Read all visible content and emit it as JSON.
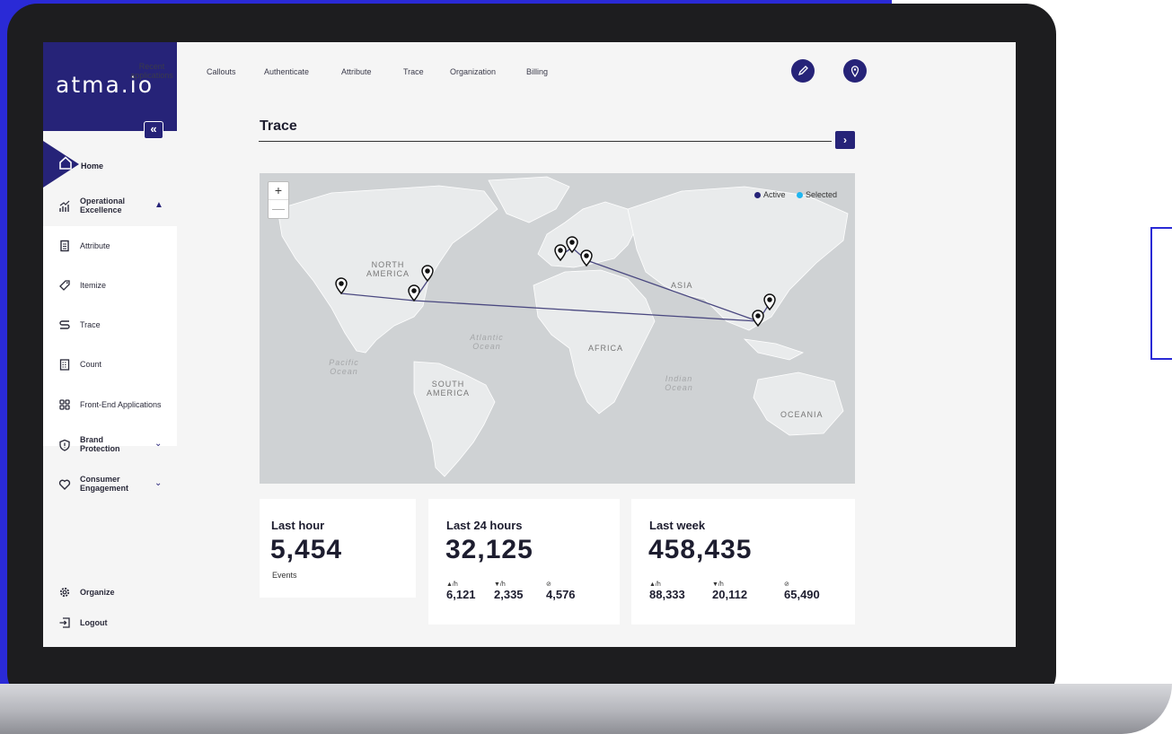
{
  "app": {
    "brand": "atma.io",
    "collapse_symbol": "«"
  },
  "sidebar": {
    "home": "Home",
    "operational": "Operational Excellence",
    "items": [
      {
        "label": "Attribute",
        "icon": "attribute-icon"
      },
      {
        "label": "Itemize",
        "icon": "tag-icon"
      },
      {
        "label": "Trace",
        "icon": "trace-icon"
      },
      {
        "label": "Count",
        "icon": "count-icon"
      },
      {
        "label": "Front-End Applications",
        "icon": "apps-icon"
      }
    ],
    "brand_protection": "Brand Protection",
    "consumer_engagement": "Consumer Engagement",
    "organize": "Organize",
    "logout": "Logout"
  },
  "topnav": {
    "recent": "Recent applications",
    "items": [
      "Callouts",
      "Authenticate",
      "Attribute",
      "Trace",
      "Organization",
      "Billing"
    ]
  },
  "page": {
    "title": "Trace",
    "next_symbol": "›"
  },
  "map": {
    "zoom_in": "+",
    "zoom_out": "—",
    "legend": [
      {
        "label": "Active",
        "color": "#262378"
      },
      {
        "label": "Selected",
        "color": "#1fb6f0"
      }
    ],
    "labels": {
      "north_america": "NORTH AMERICA",
      "south_america": "SOUTH AMERICA",
      "africa": "AFRICA",
      "asia": "ASIA",
      "oceania": "OCEANIA",
      "atlantic": "Atlantic Ocean",
      "pacific": "Pacific Ocean",
      "indian": "Indian Ocean"
    }
  },
  "stats": {
    "hour": {
      "period": "Last hour",
      "value": "5,454",
      "unit": "Events"
    },
    "day": {
      "period": "Last 24 hours",
      "value": "32,125",
      "up_label": "▲/h",
      "up_value": "6,121",
      "down_label": "▼/h",
      "down_value": "2,335",
      "avg_label": "⊘",
      "avg_value": "4,576"
    },
    "week": {
      "period": "Last week",
      "value": "458,435",
      "up_label": "▲/h",
      "up_value": "88,333",
      "down_label": "▼/h",
      "down_value": "20,112",
      "avg_label": "⊘",
      "avg_value": "65,490"
    }
  },
  "colors": {
    "primary": "#262378",
    "background_blue": "#2a2ad6",
    "selected": "#1fb6f0"
  }
}
